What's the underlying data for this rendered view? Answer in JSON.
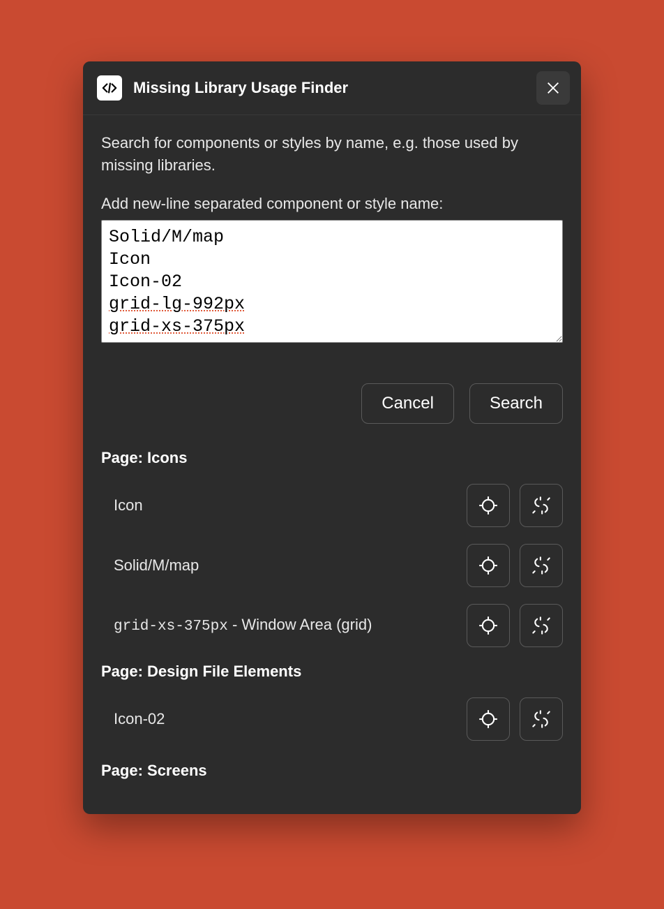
{
  "header": {
    "title": "Missing Library Usage Finder"
  },
  "instructions": {
    "description": "Search for components or styles by name, e.g. those used by missing libraries.",
    "input_label": "Add new-line separated component or style name:"
  },
  "textarea": {
    "lines": [
      {
        "text": "Solid/M/map",
        "spellerr": false
      },
      {
        "text": "Icon",
        "spellerr": false
      },
      {
        "text": "Icon-02",
        "spellerr": false
      },
      {
        "text": "grid-lg-992px",
        "spellerr": true
      },
      {
        "text": "grid-xs-375px",
        "spellerr": true
      }
    ]
  },
  "buttons": {
    "cancel": "Cancel",
    "search": "Search"
  },
  "results": {
    "pages": [
      {
        "heading": "Page: Icons",
        "items": [
          {
            "label_plain": "Icon"
          },
          {
            "label_plain": "Solid/M/map"
          },
          {
            "label_mono": "grid-xs-375px",
            "label_suffix": " - Window Area (grid)"
          }
        ]
      },
      {
        "heading": "Page: Design File Elements",
        "items": [
          {
            "label_plain": "Icon-02"
          }
        ]
      },
      {
        "heading": "Page: Screens",
        "items": []
      }
    ]
  }
}
